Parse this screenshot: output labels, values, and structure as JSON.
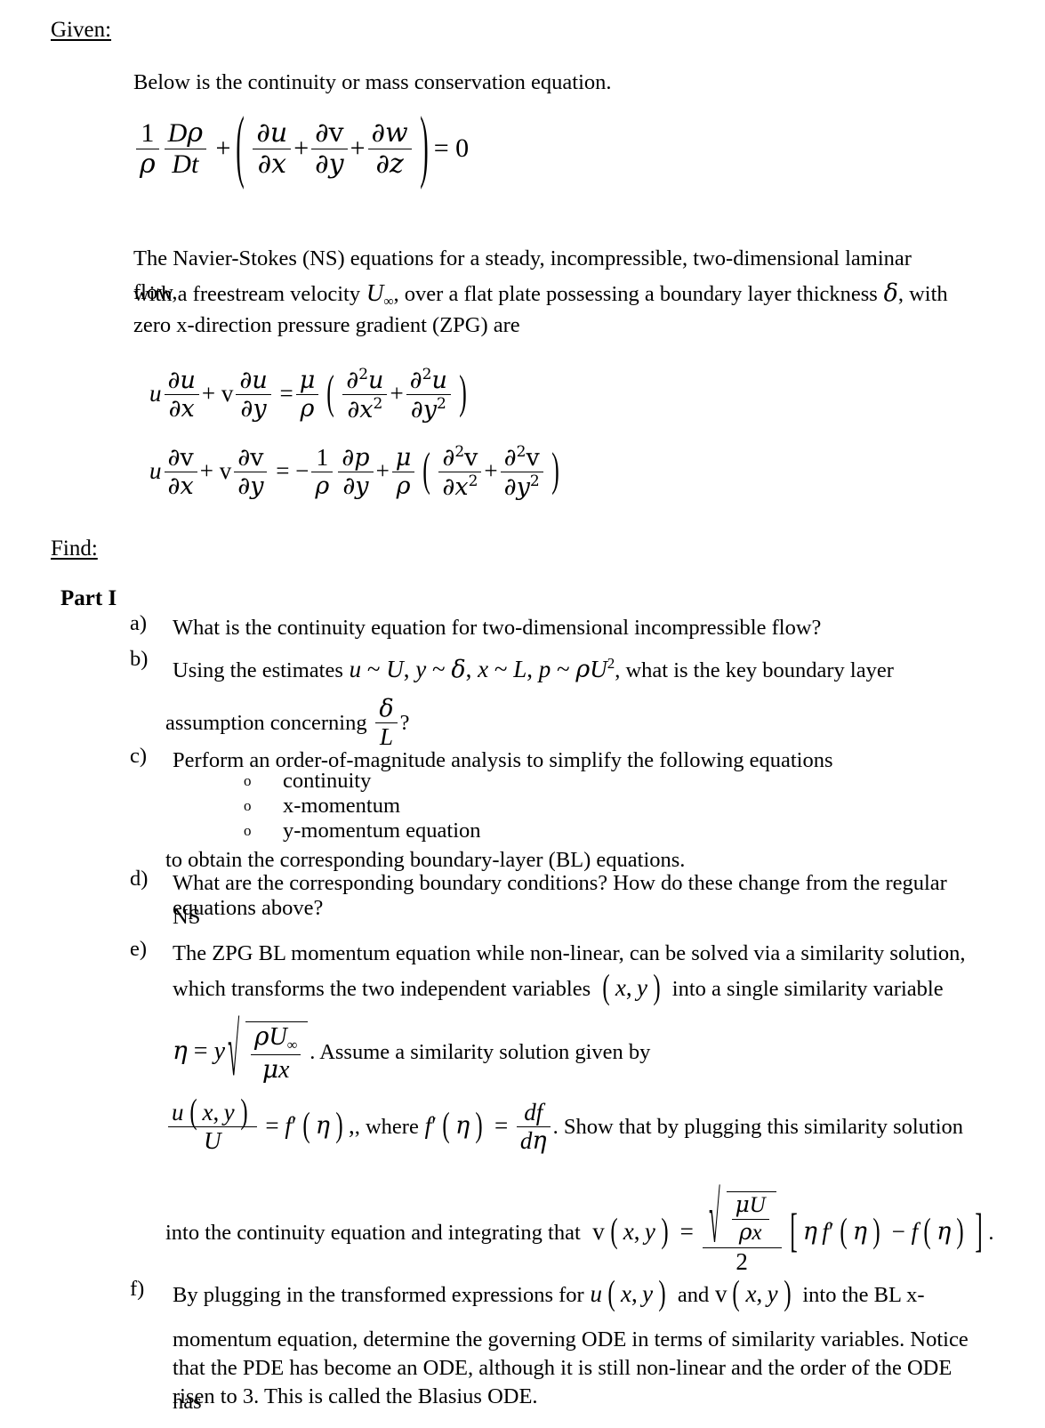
{
  "document": {
    "sections": {
      "given_label": "Given:",
      "find_label": "Find:",
      "part_label": "Part I"
    },
    "intro": {
      "continuity_intro": "Below is the continuity or mass conservation equation."
    },
    "ns_paragraph": {
      "line1": "The Navier-Stokes (NS) equations for a steady, incompressible, two-dimensional laminar flow,",
      "line2_a": "with a freestream velocity",
      "line2_b": ", over a flat plate possessing a boundary layer thickness",
      "line2_c": ", with",
      "line3": "zero x-direction pressure gradient (ZPG) are"
    },
    "items": {
      "a": {
        "label": "a)",
        "text": "What is the continuity equation for two-dimensional incompressible flow?"
      },
      "b": {
        "label": "b)",
        "text_before": "Using the estimates",
        "text_after": ", what is the key boundary layer",
        "line2_before": "assumption concerning",
        "line2_after": "?"
      },
      "c": {
        "label": "c)",
        "text": "Perform an order-of-magnitude analysis to simplify the following equations",
        "bullets": [
          "continuity",
          "x-momentum",
          "y-momentum equation"
        ],
        "closing": "to obtain the corresponding boundary-layer (BL) equations."
      },
      "d": {
        "label": "d)",
        "line1": "What are the corresponding boundary conditions?  How do these change from the regular NS",
        "line2": "equations above?"
      },
      "e": {
        "label": "e)",
        "line1": "The ZPG BL momentum equation while non-linear, can be solved via a similarity solution,",
        "line2_before": "which transforms the two independent variables",
        "line2_after": "into a single similarity variable",
        "eta_after": ". Assume a similarity solution given by",
        "uxy_mid": ", where",
        "uxy_after": ".  Show that by plugging this similarity solution",
        "v_before": "into the continuity equation and integrating that",
        "v_after": "."
      },
      "f": {
        "label": "f)",
        "line1_before": "By plugging in the transformed expressions for",
        "line1_mid": "and",
        "line1_after": "into the BL x-",
        "line2": "momentum equation, determine the governing ODE in terms of similarity variables.  Notice",
        "line3": "that the PDE has become an ODE, although it is still non-linear and the order of the ODE has",
        "line4": "risen to 3.   This is called the Blasius ODE."
      }
    },
    "equations": {
      "continuity": {
        "name": "mass-conservation-equation",
        "latex_like": "(1/rho)(D rho / D t) + (du/dx + dv/dy + dw/dz) = 0",
        "terms": {
          "one": "1",
          "rho": "ρ",
          "Drho": "Dρ",
          "Dt": "Dt",
          "plus": "+",
          "du": "∂u",
          "dx": "∂x",
          "dv": "∂v",
          "dy": "∂y",
          "dw": "∂w",
          "dz": "∂z",
          "equals": "= 0"
        }
      },
      "x_momentum": {
        "name": "x-momentum-navier-stokes",
        "latex_like": "u du/dx + v du/dy = (mu/rho)(d2u/dx2 + d2u/dy2)"
      },
      "y_momentum": {
        "name": "y-momentum-navier-stokes",
        "latex_like": "u dv/dx + v dv/dy = -(1/rho)(dp/dy) + (mu/rho)(d2v/dx2 + d2v/dy2)"
      },
      "estimates": {
        "name": "order-of-magnitude-estimates",
        "latex_like": "u ~ U, y ~ delta, x ~ L, p ~ rho U^2"
      },
      "delta_over_L": {
        "name": "delta-over-L-ratio",
        "num": "δ",
        "den": "L"
      },
      "eta_definition": {
        "name": "similarity-variable-eta",
        "latex_like": "eta = y sqrt(rho U_inf / (mu x))"
      },
      "u_similarity": {
        "name": "u-similarity-solution",
        "latex_like": "u(x,y)/U = f'(eta), where f'(eta) = df/d eta"
      },
      "v_similarity": {
        "name": "v-similarity-solution",
        "latex_like": "v(x,y) = sqrt(mu U / (rho x))/2 [ eta f'(eta) - f(eta) ]"
      },
      "xy_pair": {
        "name": "independent-variables-pair",
        "latex_like": "(x, y)"
      },
      "u_xy": {
        "name": "u-of-x-y",
        "latex_like": "u(x,y)"
      },
      "v_xy": {
        "name": "v-of-x-y",
        "latex_like": "v(x,y)"
      }
    },
    "symbols": {
      "U_infinity": "U∞",
      "delta": "δ",
      "partial": "∂",
      "rho": "ρ",
      "mu": "μ",
      "eta": "η",
      "bullet_mark": "o"
    },
    "colors": {
      "text": "#000000",
      "background": "#ffffff"
    }
  }
}
